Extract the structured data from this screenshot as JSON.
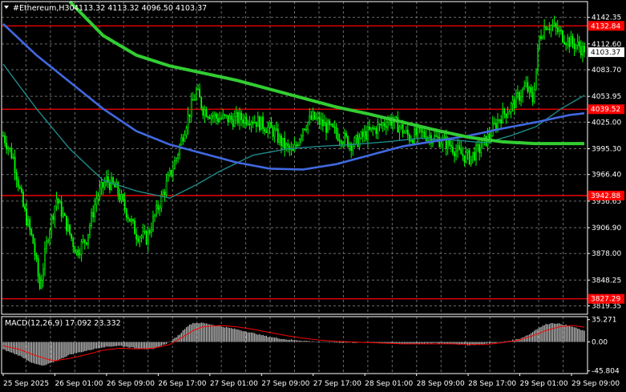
{
  "header": {
    "symbol_label": "#Ethereum,H30",
    "ohlc": "4113.32 4113.32 4096.50 4103.37"
  },
  "macd_header": {
    "label": "MACD(12,26,9) 17.092 23.332"
  },
  "colors": {
    "background": "#000000",
    "grid": "#6b6b6b",
    "candle": "#00ff00",
    "level_line": "#ff0000",
    "ma_fast": "#1f8a8a",
    "ma_mid": "#4169e1",
    "ma_slow": "#32cd32",
    "macd_hist": "#c0c0c0",
    "macd_signal": "#ff0000",
    "axis_text": "#ffffff",
    "price_tag_bg": "#ffffff",
    "price_tag_text": "#000000"
  },
  "chart_data": {
    "type": "candlestick",
    "symbol": "#Ethereum",
    "price_axis": {
      "ticks": [
        "4142.35",
        "4112.60",
        "4083.70",
        "4053.95",
        "4025.00",
        "3995.30",
        "3966.40",
        "3936.65",
        "3906.90",
        "3878.00",
        "3848.25",
        "3819.35"
      ],
      "ylim": [
        3810,
        4160
      ]
    },
    "time_axis": {
      "ticks": [
        "25 Sep 2025",
        "26 Sep 01:00",
        "26 Sep 09:00",
        "26 Sep 17:00",
        "27 Sep 01:00",
        "27 Sep 09:00",
        "27 Sep 17:00",
        "28 Sep 01:00",
        "28 Sep 09:00",
        "28 Sep 17:00",
        "29 Sep 01:00",
        "29 Sep 09:00"
      ]
    },
    "current_price": "4103.37",
    "levels": [
      {
        "label": "4132.84",
        "value": 4132.84
      },
      {
        "label": "4039.52",
        "value": 4039.52
      },
      {
        "label": "3942.88",
        "value": 3942.88
      },
      {
        "label": "3827.29",
        "value": 3827.29
      }
    ],
    "price_path": [
      [
        0,
        4010
      ],
      [
        6,
        3985
      ],
      [
        12,
        3930
      ],
      [
        18,
        3890
      ],
      [
        22,
        3840
      ],
      [
        27,
        3900
      ],
      [
        32,
        3940
      ],
      [
        38,
        3910
      ],
      [
        44,
        3880
      ],
      [
        50,
        3895
      ],
      [
        56,
        3940
      ],
      [
        62,
        3960
      ],
      [
        68,
        3950
      ],
      [
        74,
        3925
      ],
      [
        80,
        3900
      ],
      [
        86,
        3895
      ],
      [
        92,
        3925
      ],
      [
        98,
        3955
      ],
      [
        104,
        3985
      ],
      [
        110,
        4025
      ],
      [
        116,
        4060
      ],
      [
        120,
        4040
      ],
      [
        128,
        4030
      ],
      [
        138,
        4028
      ],
      [
        148,
        4030
      ],
      [
        156,
        4022
      ],
      [
        162,
        4015
      ],
      [
        168,
        4000
      ],
      [
        174,
        3990
      ],
      [
        180,
        4020
      ],
      [
        186,
        4030
      ],
      [
        194,
        4020
      ],
      [
        202,
        4010
      ],
      [
        210,
        4000
      ],
      [
        218,
        4012
      ],
      [
        226,
        4020
      ],
      [
        232,
        4028
      ],
      [
        238,
        4020
      ],
      [
        244,
        4008
      ],
      [
        250,
        4012
      ],
      [
        256,
        4010
      ],
      [
        262,
        4005
      ],
      [
        268,
        4000
      ],
      [
        274,
        3990
      ],
      [
        280,
        3985
      ],
      [
        286,
        3995
      ],
      [
        292,
        4010
      ],
      [
        298,
        4030
      ],
      [
        304,
        4040
      ],
      [
        310,
        4055
      ],
      [
        314,
        4065
      ],
      [
        318,
        4050
      ],
      [
        322,
        4120
      ],
      [
        326,
        4135
      ],
      [
        330,
        4132
      ],
      [
        334,
        4125
      ],
      [
        338,
        4118
      ],
      [
        342,
        4113
      ],
      [
        346,
        4110
      ],
      [
        349,
        4103.37
      ]
    ],
    "ma_fast_path": [
      [
        0,
        4090
      ],
      [
        20,
        4040
      ],
      [
        40,
        3995
      ],
      [
        60,
        3960
      ],
      [
        80,
        3948
      ],
      [
        100,
        3940
      ],
      [
        116,
        3955
      ],
      [
        130,
        3970
      ],
      [
        150,
        3988
      ],
      [
        170,
        3995
      ],
      [
        190,
        3998
      ],
      [
        210,
        4000
      ],
      [
        230,
        4003
      ],
      [
        250,
        4007
      ],
      [
        270,
        4005
      ],
      [
        290,
        4002
      ],
      [
        305,
        4010
      ],
      [
        320,
        4020
      ],
      [
        335,
        4040
      ],
      [
        349,
        4055
      ]
    ],
    "ma_mid_path": [
      [
        0,
        4135
      ],
      [
        20,
        4100
      ],
      [
        40,
        4070
      ],
      [
        60,
        4040
      ],
      [
        80,
        4015
      ],
      [
        100,
        4000
      ],
      [
        120,
        3990
      ],
      [
        140,
        3980
      ],
      [
        160,
        3973
      ],
      [
        180,
        3972
      ],
      [
        200,
        3978
      ],
      [
        220,
        3988
      ],
      [
        240,
        3998
      ],
      [
        260,
        4004
      ],
      [
        280,
        4010
      ],
      [
        300,
        4018
      ],
      [
        320,
        4025
      ],
      [
        340,
        4033
      ],
      [
        349,
        4035
      ]
    ],
    "ma_slow_path": [
      [
        40,
        4160
      ],
      [
        60,
        4122
      ],
      [
        80,
        4100
      ],
      [
        100,
        4088
      ],
      [
        120,
        4080
      ],
      [
        140,
        4072
      ],
      [
        160,
        4062
      ],
      [
        180,
        4052
      ],
      [
        200,
        4042
      ],
      [
        220,
        4034
      ],
      [
        240,
        4025
      ],
      [
        260,
        4016
      ],
      [
        280,
        4008
      ],
      [
        300,
        4003
      ],
      [
        320,
        4001
      ],
      [
        349,
        4001
      ]
    ],
    "macd": {
      "ticks": [
        "35.271",
        "0.00",
        "-45.804"
      ],
      "ylim": [
        -50,
        40
      ],
      "histogram_path": [
        [
          0,
          -12
        ],
        [
          10,
          -22
        ],
        [
          18,
          -34
        ],
        [
          24,
          -38
        ],
        [
          32,
          -30
        ],
        [
          40,
          -20
        ],
        [
          50,
          -14
        ],
        [
          60,
          -8
        ],
        [
          70,
          -6
        ],
        [
          80,
          -10
        ],
        [
          90,
          -12
        ],
        [
          100,
          0
        ],
        [
          106,
          12
        ],
        [
          110,
          24
        ],
        [
          114,
          30
        ],
        [
          120,
          30
        ],
        [
          128,
          26
        ],
        [
          140,
          20
        ],
        [
          150,
          14
        ],
        [
          160,
          8
        ],
        [
          170,
          4
        ],
        [
          180,
          2
        ],
        [
          190,
          0
        ],
        [
          200,
          -1
        ],
        [
          210,
          -1
        ],
        [
          220,
          -1
        ],
        [
          230,
          -2
        ],
        [
          240,
          -3
        ],
        [
          250,
          -3
        ],
        [
          260,
          -2
        ],
        [
          270,
          -3
        ],
        [
          280,
          -5
        ],
        [
          290,
          -3
        ],
        [
          300,
          0
        ],
        [
          310,
          5
        ],
        [
          316,
          12
        ],
        [
          320,
          20
        ],
        [
          326,
          28
        ],
        [
          330,
          30
        ],
        [
          336,
          28
        ],
        [
          342,
          24
        ],
        [
          349,
          17.092
        ]
      ],
      "signal_path": [
        [
          0,
          -6
        ],
        [
          10,
          -12
        ],
        [
          20,
          -22
        ],
        [
          30,
          -30
        ],
        [
          40,
          -26
        ],
        [
          50,
          -20
        ],
        [
          60,
          -13
        ],
        [
          70,
          -10
        ],
        [
          80,
          -11
        ],
        [
          90,
          -10
        ],
        [
          100,
          -4
        ],
        [
          108,
          8
        ],
        [
          114,
          18
        ],
        [
          120,
          24
        ],
        [
          130,
          26
        ],
        [
          140,
          24
        ],
        [
          150,
          20
        ],
        [
          160,
          15
        ],
        [
          170,
          10
        ],
        [
          180,
          6
        ],
        [
          190,
          3
        ],
        [
          200,
          1
        ],
        [
          210,
          0
        ],
        [
          220,
          -1
        ],
        [
          230,
          -2
        ],
        [
          240,
          -3
        ],
        [
          250,
          -3
        ],
        [
          260,
          -3
        ],
        [
          270,
          -3
        ],
        [
          280,
          -4
        ],
        [
          290,
          -4
        ],
        [
          300,
          -1
        ],
        [
          310,
          3
        ],
        [
          318,
          10
        ],
        [
          326,
          18
        ],
        [
          334,
          24
        ],
        [
          342,
          26
        ],
        [
          349,
          23.332
        ]
      ]
    }
  }
}
